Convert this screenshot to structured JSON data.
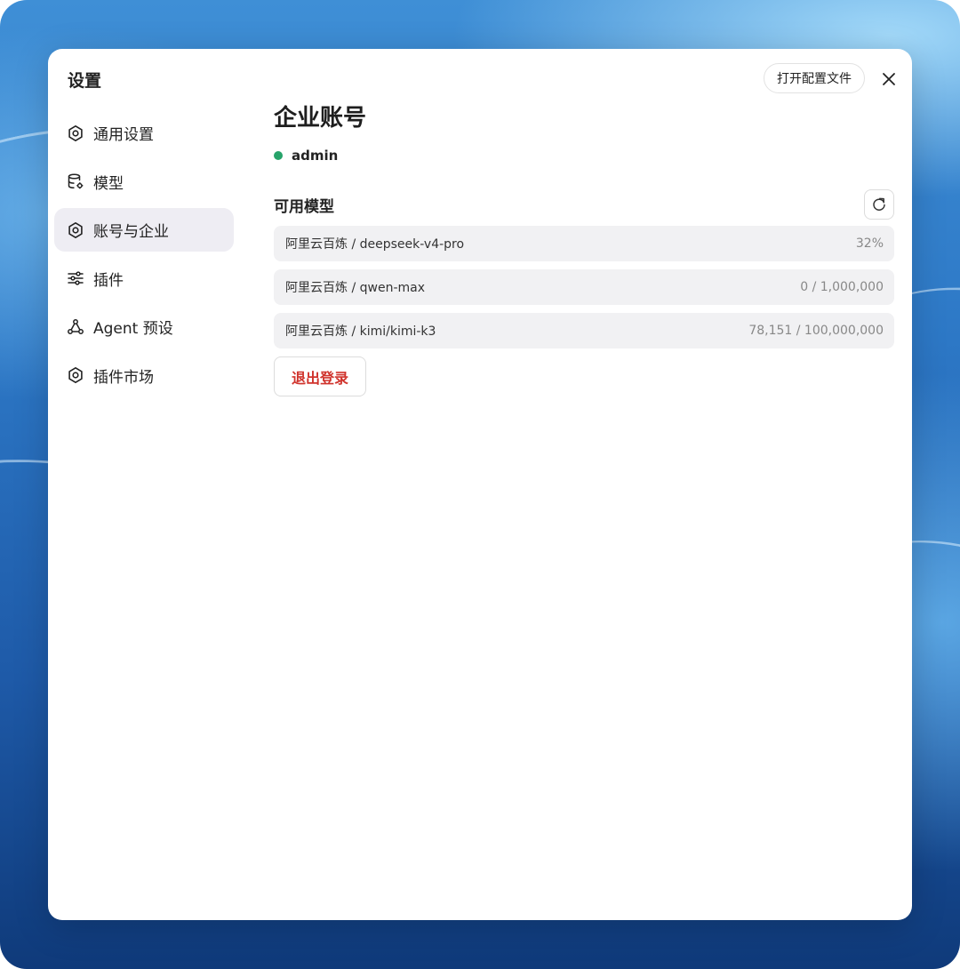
{
  "dialog": {
    "title": "设置",
    "open_config_label": "打开配置文件"
  },
  "sidebar": {
    "items": [
      {
        "label": "通用设置",
        "icon": "gear-icon"
      },
      {
        "label": "模型",
        "icon": "database-gear-icon"
      },
      {
        "label": "账号与企业",
        "icon": "gear-icon",
        "active": true
      },
      {
        "label": "插件",
        "icon": "sliders-icon"
      },
      {
        "label": "Agent 预设",
        "icon": "agent-network-icon"
      },
      {
        "label": "插件市场",
        "icon": "gear-icon"
      }
    ]
  },
  "main": {
    "title": "企业账号",
    "user": {
      "name": "admin",
      "status_color": "#27a36a"
    },
    "models_section_title": "可用模型",
    "models": [
      {
        "name": "阿里云百炼 / deepseek-v4-pro",
        "usage": "32%"
      },
      {
        "name": "阿里云百炼 / qwen-max",
        "usage": "0 / 1,000,000"
      },
      {
        "name": "阿里云百炼 / kimi/kimi-k3",
        "usage": "78,151 / 100,000,000"
      }
    ],
    "logout_label": "退出登录"
  },
  "colors": {
    "danger": "#d0332c",
    "active_nav_bg": "#eeedf3",
    "row_bg": "#f1f1f3"
  }
}
